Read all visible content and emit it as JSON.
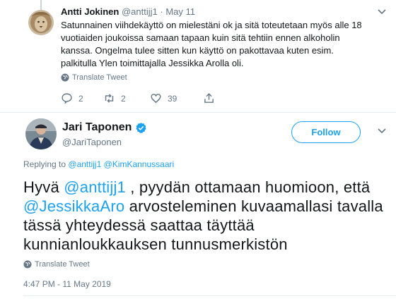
{
  "colors": {
    "link": "#1da1f2",
    "secondary_text": "#657786",
    "primary_text": "#14171a",
    "verified": "#1da1f2",
    "like_active": "#657786"
  },
  "reply": {
    "author_name": "Antti Jokinen",
    "handle": "@anttijj1",
    "separator": "·",
    "date": "May 11",
    "text": "Satunnainen viihdekäyttö on mielestäni ok ja sitä toteutetaan myös alle 18 vuotiaiden joukoissa samaan tapaan kuin sitä tehtiin ennen alkoholin kanssa. Ongelma tulee sitten kun käyttö on pakottavaa kuten esim. palkitulla Ylen toimittajalla Jessikka Arolla oli.",
    "translate_label": "Translate Tweet",
    "reply_count": "2",
    "retweet_count": "2",
    "like_count": "39",
    "icons": [
      "reply-icon",
      "retweet-icon",
      "like-icon",
      "share-icon",
      "caret-down-icon",
      "globe-icon"
    ]
  },
  "main": {
    "author_name": "Jari Taponen",
    "handle": "@JariTaponen",
    "follow_label": "Follow",
    "replying_prefix": "Replying to",
    "replying_mention_1": "@anttijj1",
    "replying_mention_2": "@KimKannussaari",
    "text_part_1": "Hyvä ",
    "text_mention_1": "@anttijj1",
    "text_part_2": " , pyydän ottamaan huomioon, että ",
    "text_mention_2": "@JessikkaAro",
    "text_part_3": " arvosteleminen kuvaamallasi tavalla tässä yhteydessä saattaa täyttää kunnianloukkauksen tunnusmerkistön",
    "translate_label": "Translate Tweet",
    "timestamp": "4:47 PM - 11 May 2019",
    "icons": [
      "verified-badge-icon",
      "chevron-down-icon",
      "globe-icon"
    ]
  }
}
